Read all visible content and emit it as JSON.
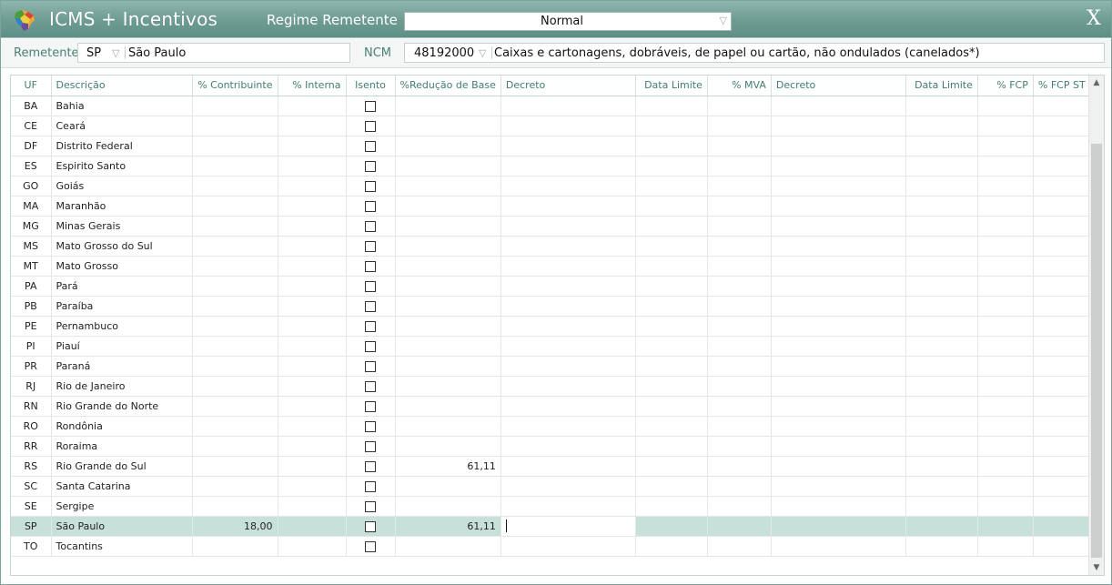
{
  "window": {
    "title": "ICMS + Incentivos",
    "regime_label": "Regime Remetente",
    "regime_value": "Normal",
    "close_glyph": "X"
  },
  "filter": {
    "remetente_label": "Remetente",
    "remetente_uf": "SP",
    "remetente_name": "São Paulo",
    "ncm_label": "NCM",
    "ncm_code": "48192000",
    "ncm_description": "Caixas e cartonagens, dobráveis, de papel ou cartão, não ondulados (canelados*)"
  },
  "grid": {
    "columns": [
      "UF",
      "Descrição",
      "% Contribuinte",
      "% Interna",
      "Isento",
      "%Redução de Base",
      "Decreto",
      "Data Limite",
      "% MVA",
      "Decreto",
      "Data Limite",
      "% FCP",
      "% FCP ST"
    ],
    "rows": [
      {
        "uf": "BA",
        "desc": "Bahia",
        "contrib": "",
        "reducao": ""
      },
      {
        "uf": "CE",
        "desc": "Ceará",
        "contrib": "",
        "reducao": ""
      },
      {
        "uf": "DF",
        "desc": "Distrito Federal",
        "contrib": "",
        "reducao": ""
      },
      {
        "uf": "ES",
        "desc": "Espirito Santo",
        "contrib": "",
        "reducao": ""
      },
      {
        "uf": "GO",
        "desc": "Goiás",
        "contrib": "",
        "reducao": ""
      },
      {
        "uf": "MA",
        "desc": "Maranhão",
        "contrib": "",
        "reducao": ""
      },
      {
        "uf": "MG",
        "desc": "Minas Gerais",
        "contrib": "",
        "reducao": ""
      },
      {
        "uf": "MS",
        "desc": "Mato Grosso do Sul",
        "contrib": "",
        "reducao": ""
      },
      {
        "uf": "MT",
        "desc": "Mato Grosso",
        "contrib": "",
        "reducao": ""
      },
      {
        "uf": "PA",
        "desc": "Pará",
        "contrib": "",
        "reducao": ""
      },
      {
        "uf": "PB",
        "desc": "Paraíba",
        "contrib": "",
        "reducao": ""
      },
      {
        "uf": "PE",
        "desc": "Pernambuco",
        "contrib": "",
        "reducao": ""
      },
      {
        "uf": "PI",
        "desc": "Piauí",
        "contrib": "",
        "reducao": ""
      },
      {
        "uf": "PR",
        "desc": "Paraná",
        "contrib": "",
        "reducao": ""
      },
      {
        "uf": "RJ",
        "desc": "Rio de Janeiro",
        "contrib": "",
        "reducao": ""
      },
      {
        "uf": "RN",
        "desc": "Rio Grande do Norte",
        "contrib": "",
        "reducao": ""
      },
      {
        "uf": "RO",
        "desc": "Rondônia",
        "contrib": "",
        "reducao": ""
      },
      {
        "uf": "RR",
        "desc": "Roraima",
        "contrib": "",
        "reducao": ""
      },
      {
        "uf": "RS",
        "desc": "Rio Grande do Sul",
        "contrib": "",
        "reducao": "61,11"
      },
      {
        "uf": "SC",
        "desc": "Santa Catarina",
        "contrib": "",
        "reducao": ""
      },
      {
        "uf": "SE",
        "desc": "Sergipe",
        "contrib": "",
        "reducao": ""
      },
      {
        "uf": "SP",
        "desc": "São Paulo",
        "contrib": "18,00",
        "reducao": "61,11",
        "selected": true
      },
      {
        "uf": "TO",
        "desc": "Tocantins",
        "contrib": "",
        "reducao": ""
      }
    ]
  },
  "colors": {
    "titlebar": "#6f9d94",
    "header_text": "#3f7d73",
    "selected_row": "#c8e0da"
  },
  "icons": {
    "logo": "brazil-map-icon",
    "dropdown": "triangle-down-icon",
    "scroll_up": "chevron-up-icon",
    "scroll_down": "chevron-down-icon"
  }
}
